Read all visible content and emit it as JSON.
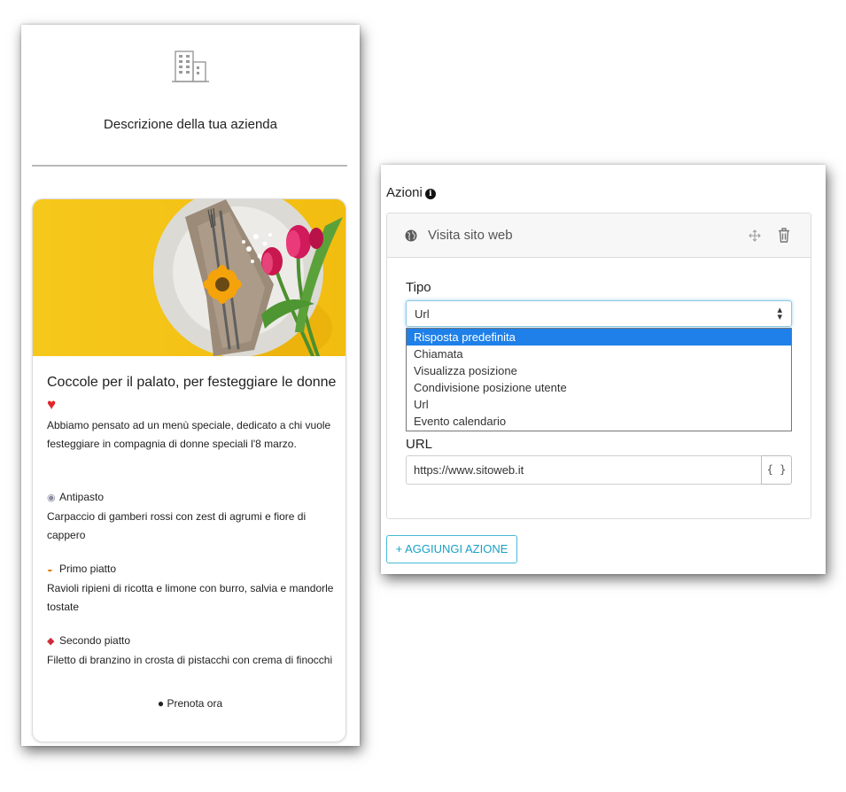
{
  "preview": {
    "company_description": "Descrizione della tua azienda",
    "card": {
      "title": "Coccole per il palato, per festeggiare le donne",
      "intro": "Abbiamo pensato ad un menù speciale, dedicato a chi vuole festeggiare in compagnia di donne speciali l'8 marzo.",
      "courses": [
        {
          "icon": "plate-icon",
          "name": "Antipasto",
          "description": "Carpaccio di gamberi rossi con zest di agrumi e fiore di cappero"
        },
        {
          "icon": "pasta-icon",
          "name": "Primo piatto",
          "description": "Ravioli ripieni di ricotta e limone con burro, salvia e mandorle tostate"
        },
        {
          "icon": "meat-icon",
          "name": "Secondo piatto",
          "description": "Filetto di branzino in crosta di pistacchi con crema di finocchi"
        }
      ],
      "button_label": "Prenota ora"
    }
  },
  "panel": {
    "title": "Azioni",
    "action": {
      "header_label": "Visita sito web",
      "type_label": "Tipo",
      "type_value": "Url",
      "options": [
        "Risposta predefinita",
        "Chiamata",
        "Visualizza posizione",
        "Condivisione posizione utente",
        "Url",
        "Evento calendario"
      ],
      "highlighted_option": "Risposta predefinita",
      "url_label": "URL",
      "url_value": "https://www.sitoweb.it",
      "variable_button": "{ }"
    },
    "add_button": "+ AGGIUNGI AZIONE"
  },
  "colors": {
    "accent": "#1aa0c5",
    "selection": "#1e80e8",
    "image_background": "#f3c51c",
    "heart": "#e0262e"
  }
}
